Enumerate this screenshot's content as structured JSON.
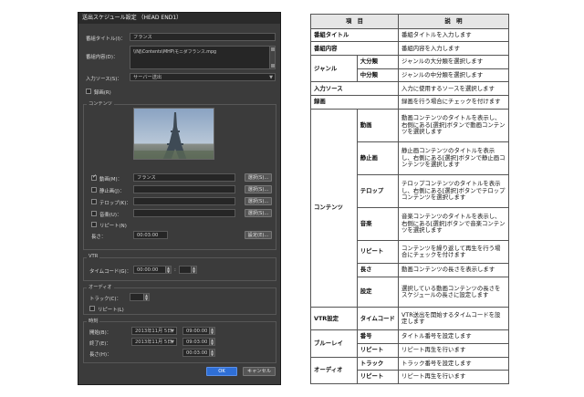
{
  "dialog": {
    "title": "送出スケジュール設定 （HEAD END1）",
    "program_title_label": "番組タイトル(I)：",
    "program_title_value": "フランス",
    "program_content_label": "番組内容(D)：",
    "program_content_value": "\\\\NJ\\Contents\\MHP\\モニダフランス.mpg",
    "input_source_label": "入力ソース(S)：",
    "input_source_value": "サーバー送出",
    "record_label": "録画(R)",
    "content_group": "コンテンツ",
    "video_label": "動画(M)：",
    "video_value": "フランス",
    "still_label": "静止画(J)：",
    "telop_label": "テロップ(K)：",
    "audio_label": "音楽(U)：",
    "repeat_label": "リピート(N)",
    "length_label": "長さ：",
    "length_value": "00:03:00",
    "select_label": "選択(S)...",
    "settings_label": "設定(E)...",
    "vtr_group": "VTR",
    "timecode_label": "タイムコード(G)：",
    "timecode_value": "00:00:00",
    "timecode_frame_sep": ":",
    "audio_group": "オーディオ",
    "track_label": "トラック(C)：",
    "repeat2_label": "リピート(L)",
    "time_group": "時刻",
    "start_label": "開始(B)：",
    "start_date": "2013年11月 5日",
    "start_time": "09:00:00",
    "end_label": "終了(E)：",
    "end_date": "2013年11月 5日",
    "end_time": "09:03:00",
    "duration_label": "長さ(H)：",
    "duration_value": "00:03:00",
    "ok_label": "OK",
    "cancel_label": "キャンセル"
  },
  "table": {
    "header_item": "項　目",
    "header_desc": "説　明",
    "rows": {
      "title_item": "番組タイトル",
      "title_desc": "番組タイトルを入力します",
      "content_item": "番組内容",
      "content_desc": "番組内容を入力します",
      "genre": "ジャンル",
      "genre_major": "大分類",
      "genre_major_desc": "ジャンルの大分類を選択します",
      "genre_mid": "中分類",
      "genre_mid_desc": "ジャンルの中分類を選択します",
      "input_item": "入力ソース",
      "input_desc": "入力に使用するソースを選択します",
      "record_item": "録画",
      "record_desc": "録画を行う場合にチェックを付けます",
      "contents": "コンテンツ",
      "video": "動画",
      "video_desc": "動画コンテンツのタイトルを表示し、右側にある[選択]ボタンで動画コンテンツを選択します",
      "still": "静止画",
      "still_desc": "静止画コンテンツのタイトルを表示し、右側にある[選択]ボタンで静止画コンテンツを選択します",
      "telop": "テロップ",
      "telop_desc": "テロップコンテンツのタイトルを表示し、右側にある[選択]ボタンでテロップコンテンツを選択します",
      "music": "音楽",
      "music_desc": "音楽コンテンツのタイトルを表示し、右側にある[選択]ボタンで音楽コンテンツを選択します",
      "repeat": "リピート",
      "repeat_desc": "コンテンツを繰り返して再生を行う場合にチェックを付けます",
      "length": "長さ",
      "length_desc": "動画コンテンツの長さを表示します",
      "setting": "設定",
      "setting_desc": "選択している動画コンテンツの長さをスケジュールの長さに設定します",
      "vtr": "VTR設定",
      "timecode": "タイムコード",
      "timecode_desc": "VTR送出を開始するタイムコードを設定します",
      "bluray": "ブルーレイ",
      "number": "番号",
      "number_desc": "タイトル番号を設定します",
      "br_repeat": "リピート",
      "br_repeat_desc": "リピート再生を行います",
      "audio": "オーディオ",
      "track": "トラック",
      "track_desc": "トラック番号を設定します",
      "au_repeat": "リピート",
      "au_repeat_desc": "リピート再生を行います"
    }
  }
}
